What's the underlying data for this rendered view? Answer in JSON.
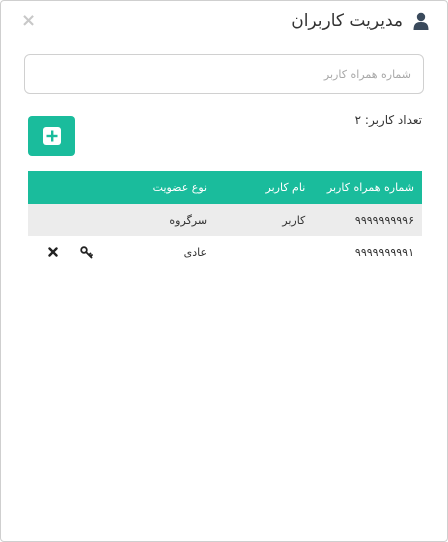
{
  "header": {
    "title": "مدیریت کاربران",
    "title_icon": "user-icon",
    "close_label": "×"
  },
  "search": {
    "placeholder": "شماره همراه کاربر",
    "value": ""
  },
  "summary": {
    "user_count_text": "تعداد کاربر: ۲",
    "add_icon": "plus-square-icon"
  },
  "table": {
    "columns": [
      "شماره همراه کاربر",
      "نام کاربر",
      "نوع عضویت",
      "",
      ""
    ],
    "rows": [
      {
        "phone": "۹۹۹۹۹۹۹۹۹۶",
        "name": "کاربر",
        "membership": "سرگروه",
        "actions": []
      },
      {
        "phone": "۹۹۹۹۹۹۹۹۹۱",
        "name": "",
        "membership": "عادی",
        "actions": [
          "key-icon",
          "remove-icon"
        ]
      }
    ]
  },
  "colors": {
    "accent": "#1abc9c",
    "row_shade": "#ececec",
    "border": "#cfcfcf"
  }
}
